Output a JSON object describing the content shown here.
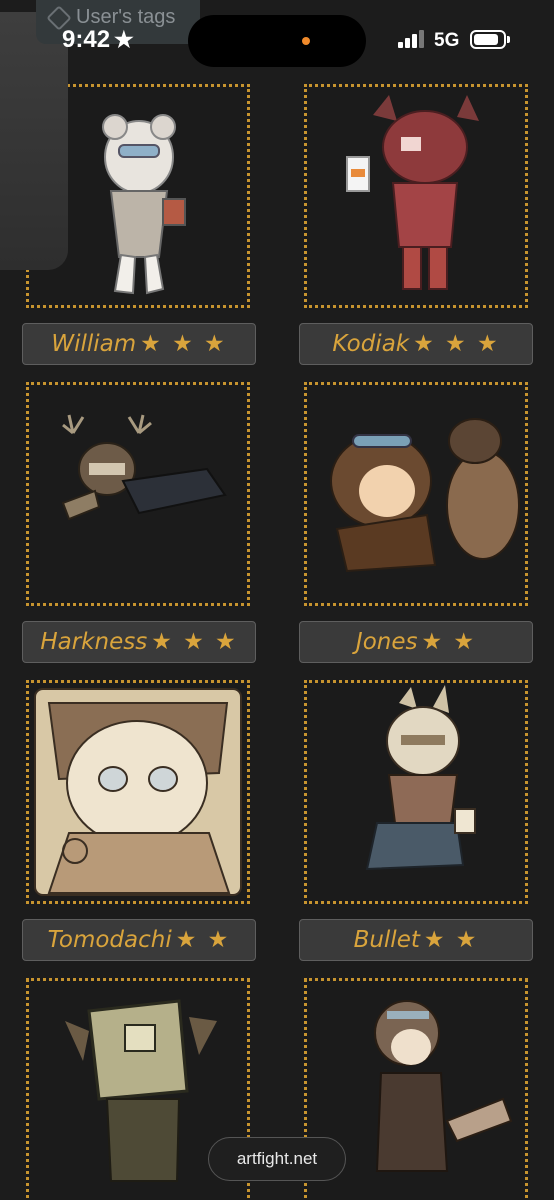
{
  "status_bar": {
    "time": "9:42",
    "network": "5G",
    "battery_level": 0.85
  },
  "tags_chip": {
    "label": "User's tags"
  },
  "characters": [
    {
      "name": "William",
      "stars": "★ ★ ★",
      "star_count": 3
    },
    {
      "name": "Kodiak",
      "stars": "★ ★ ★",
      "star_count": 3
    },
    {
      "name": "Harkness",
      "stars": "★ ★ ★",
      "star_count": 3
    },
    {
      "name": "Jones",
      "stars": "★ ★",
      "star_count": 2
    },
    {
      "name": "Tomodachi",
      "stars": "★ ★",
      "star_count": 2
    },
    {
      "name": "Bullet",
      "stars": "★ ★",
      "star_count": 2
    },
    {
      "name": "",
      "stars": "",
      "star_count": 0
    },
    {
      "name": "",
      "stars": "",
      "star_count": 0
    }
  ],
  "footer": {
    "site": "artfight.net"
  },
  "colors": {
    "background": "#1c1c1c",
    "accent_gold": "#d9a43c",
    "frame_border": "#c7942f",
    "plate_bg": "#3a3a3a"
  }
}
